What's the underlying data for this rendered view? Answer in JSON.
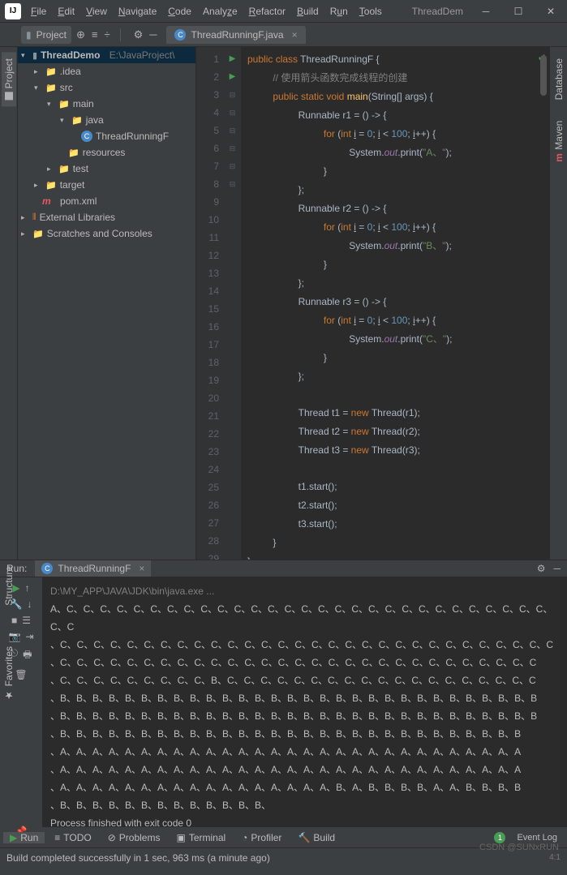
{
  "window": {
    "title": "ThreadDem"
  },
  "menu": [
    "File",
    "Edit",
    "View",
    "Navigate",
    "Code",
    "Analyze",
    "Refactor",
    "Build",
    "Run",
    "Tools"
  ],
  "toolbar": {
    "project_label": "Project",
    "tab_name": "ThreadRunningF.java"
  },
  "tree": {
    "root": "ThreadDemo",
    "root_path": "E:\\JavaProject\\",
    "idea": ".idea",
    "src": "src",
    "main": "main",
    "java": "java",
    "file": "ThreadRunningF",
    "resources": "resources",
    "test": "test",
    "target": "target",
    "pom": "pom.xml",
    "ext": "External Libraries",
    "scratch": "Scratches and Consoles"
  },
  "code": {
    "l1a": "public ",
    "l1b": "class ",
    "l1c": "ThreadRunningF ",
    "l1d": "{",
    "l2": "// 使用箭头函数完成线程的创建",
    "l3a": "public static ",
    "l3b": "void ",
    "l3c": "main",
    "l3d": "(String[] args) {",
    "l4": "Runnable r1 = () -> {",
    "l5a": "for ",
    "l5b": "(",
    "l5c": "int ",
    "l5d": "i",
    "l5e": " = ",
    "l5f": "0",
    "l5g": "; ",
    "l5h": "i",
    "l5i": " < ",
    "l5j": "100",
    "l5k": "; ",
    "l5l": "i",
    "l5m": "++) {",
    "l6a": "System.",
    "l6b": "out",
    "l6c": ".print(",
    "l6d": "\"A、\"",
    "l6e": ");",
    "l7": "}",
    "l8": "};",
    "l9": "Runnable r2 = () -> {",
    "l11d": "\"B、\"",
    "l14": "Runnable r3 = () -> {",
    "l16d": "\"C、\"",
    "l20a": "Thread t1 = ",
    "l20b": "new ",
    "l20c": "Thread(r1);",
    "l21a": "Thread t2 = ",
    "l21c": "Thread(r2);",
    "l22a": "Thread t3 = ",
    "l22c": "Thread(r3);",
    "l24": "t1.start();",
    "l25": "t2.start();",
    "l26": "t3.start();",
    "l27": "}",
    "l28": "}"
  },
  "run": {
    "label": "Run:",
    "tab": "ThreadRunningF",
    "cmd": "D:\\MY_APP\\JAVA\\JDK\\bin\\java.exe ...",
    "o1": "A、C、C、C、C、C、C、C、C、C、C、C、C、C、C、C、C、C、C、C、C、C、C、C、C、C、C、C、C、C、C、C",
    "o2": "、C、C、C、C、C、C、C、C、C、C、C、C、C、C、C、C、C、C、C、C、C、C、C、C、C、C、C、C、C、C",
    "o3": "、C、C、C、C、C、C、C、C、C、C、C、C、C、C、C、C、C、C、C、C、C、C、C、C、C、C、C、C、C",
    "o4": "、C、C、C、C、C、C、C、C、C、B、C、C、C、C、C、C、C、C、C、C、C、C、C、C、C、C、C、C、C",
    "o5": "、B、B、B、B、B、B、B、B、B、B、B、B、B、B、B、B、B、B、B、B、B、B、B、B、B、B、B、B、B、B",
    "o6": "、B、B、B、B、B、B、B、B、B、B、B、B、B、B、B、B、B、B、B、B、B、B、B、B、B、B、B、B、B、B",
    "o7": "、B、B、B、B、B、B、B、B、B、B、B、B、B、B、B、B、B、B、B、B、B、B、B、B、B、B、B、B、B",
    "o8": "、A、A、A、A、A、A、A、A、A、A、A、A、A、A、A、A、A、A、A、A、A、A、A、A、A、A、A、A、A",
    "o9": "、A、A、A、A、A、A、A、A、A、A、A、A、A、A、A、A、A、A、A、A、A、A、A、A、A、A、A、A、A",
    "o10": "、A、A、A、A、A、A、A、A、A、A、A、A、A、A、A、A、A、B、A、B、B、B、B、A、A、B、B、B、B",
    "o11": "、B、B、B、B、B、B、B、B、B、B、B、B、B、",
    "exit": "Process finished with exit code 0"
  },
  "bottom": {
    "run": "Run",
    "todo": "TODO",
    "problems": "Problems",
    "terminal": "Terminal",
    "profiler": "Profiler",
    "build": "Build",
    "event": "Event Log",
    "badge": "1"
  },
  "status": {
    "msg": "Build completed successfully in 1 sec, 963 ms (a minute ago)",
    "pos": "4:1"
  },
  "side": {
    "project": "Project",
    "database": "Database",
    "maven": "Maven",
    "structure": "Structure",
    "favorites": "Favorites"
  },
  "wm": "CSDN @SUNxRUN"
}
